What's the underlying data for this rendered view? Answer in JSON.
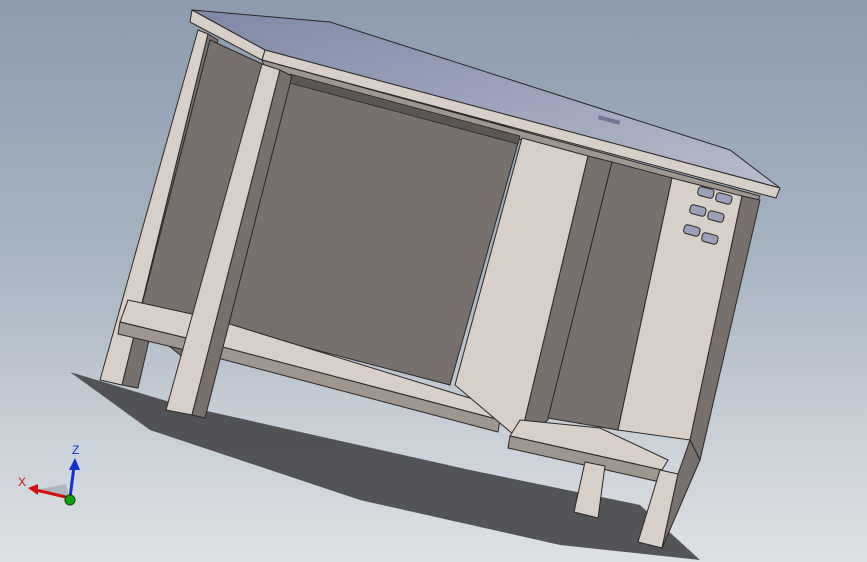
{
  "viewport": {
    "background_top": "#8c9cae",
    "background_bottom": "#dde1e5"
  },
  "model": {
    "colors": {
      "frame_dark": "#77706c",
      "frame_light": "#d8d0c8",
      "edge": "#2b2726",
      "top_surface": "#9aa0b8",
      "shadow": "#3a3a3e"
    }
  },
  "triad": {
    "x_label": "X",
    "z_label": "Z",
    "x_color": "#d01010",
    "y_color": "#10a010",
    "z_color": "#1030d0"
  }
}
